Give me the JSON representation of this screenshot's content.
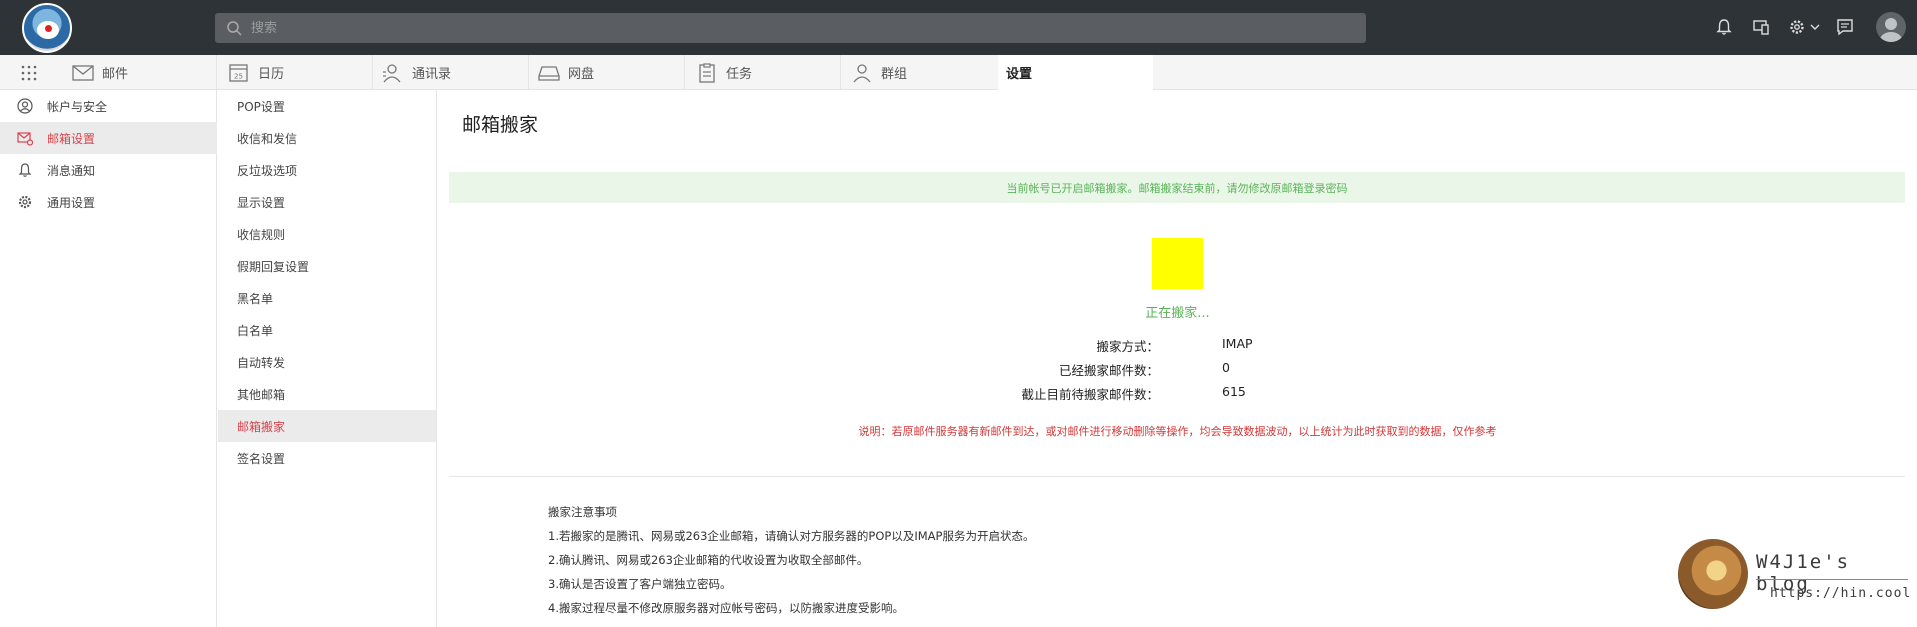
{
  "search": {
    "placeholder": "搜索"
  },
  "nav": {
    "tabs": [
      {
        "label": "邮件",
        "icon": "mail-icon"
      },
      {
        "label": "日历",
        "icon": "calendar-icon",
        "badge": "25"
      },
      {
        "label": "通讯录",
        "icon": "contacts-icon"
      },
      {
        "label": "网盘",
        "icon": "disk-icon"
      },
      {
        "label": "任务",
        "icon": "task-icon"
      },
      {
        "label": "群组",
        "icon": "group-icon"
      },
      {
        "label": "设置",
        "icon": "",
        "active": true
      }
    ]
  },
  "sidebar": {
    "items": [
      {
        "label": "帐户与安全",
        "icon": "user-circle-icon"
      },
      {
        "label": "邮箱设置",
        "icon": "mail-gear-icon",
        "active": true
      },
      {
        "label": "消息通知",
        "icon": "bell-icon"
      },
      {
        "label": "通用设置",
        "icon": "gear-icon"
      }
    ]
  },
  "submenu": {
    "items": [
      "POP设置",
      "收信和发信",
      "反垃圾选项",
      "显示设置",
      "收信规则",
      "假期回复设置",
      "黑名单",
      "白名单",
      "自动转发",
      "其他邮箱",
      "邮箱搬家",
      "签名设置"
    ],
    "active_index": 10
  },
  "main": {
    "title": "邮箱搬家",
    "notice": "当前帐号已开启邮箱搬家。邮箱搬家结束前，请勿修改原邮箱登录密码",
    "status": "正在搬家...",
    "info": [
      {
        "label": "搬家方式：",
        "value": "IMAP"
      },
      {
        "label": "已经搬家邮件数：",
        "value": "0"
      },
      {
        "label": "截止目前待搬家邮件数：",
        "value": "615"
      }
    ],
    "note": "说明：若原邮件服务器有新邮件到达，或对邮件进行移动删除等操作，均会导致数据波动，以上统计为此时获取到的数据，仅作参考",
    "tips_title": "搬家注意事项",
    "tips": [
      "1.若搬家的是腾讯、网易或263企业邮箱，请确认对方服务器的POP以及IMAP服务为开启状态。",
      "2.确认腾讯、网易或263企业邮箱的代收设置为收取全部邮件。",
      "3.确认是否设置了客户端独立密码。",
      "4.搬家过程尽量不修改原服务器对应帐号密码，以防搬家进度受影响。"
    ]
  },
  "watermark": {
    "title": "W4J1e's blog",
    "url": "https://hin.cool"
  },
  "colors": {
    "topbar": "#2e3337",
    "accent": "#d9434d",
    "success": "#5ab35a",
    "progress": "#ffff00"
  }
}
